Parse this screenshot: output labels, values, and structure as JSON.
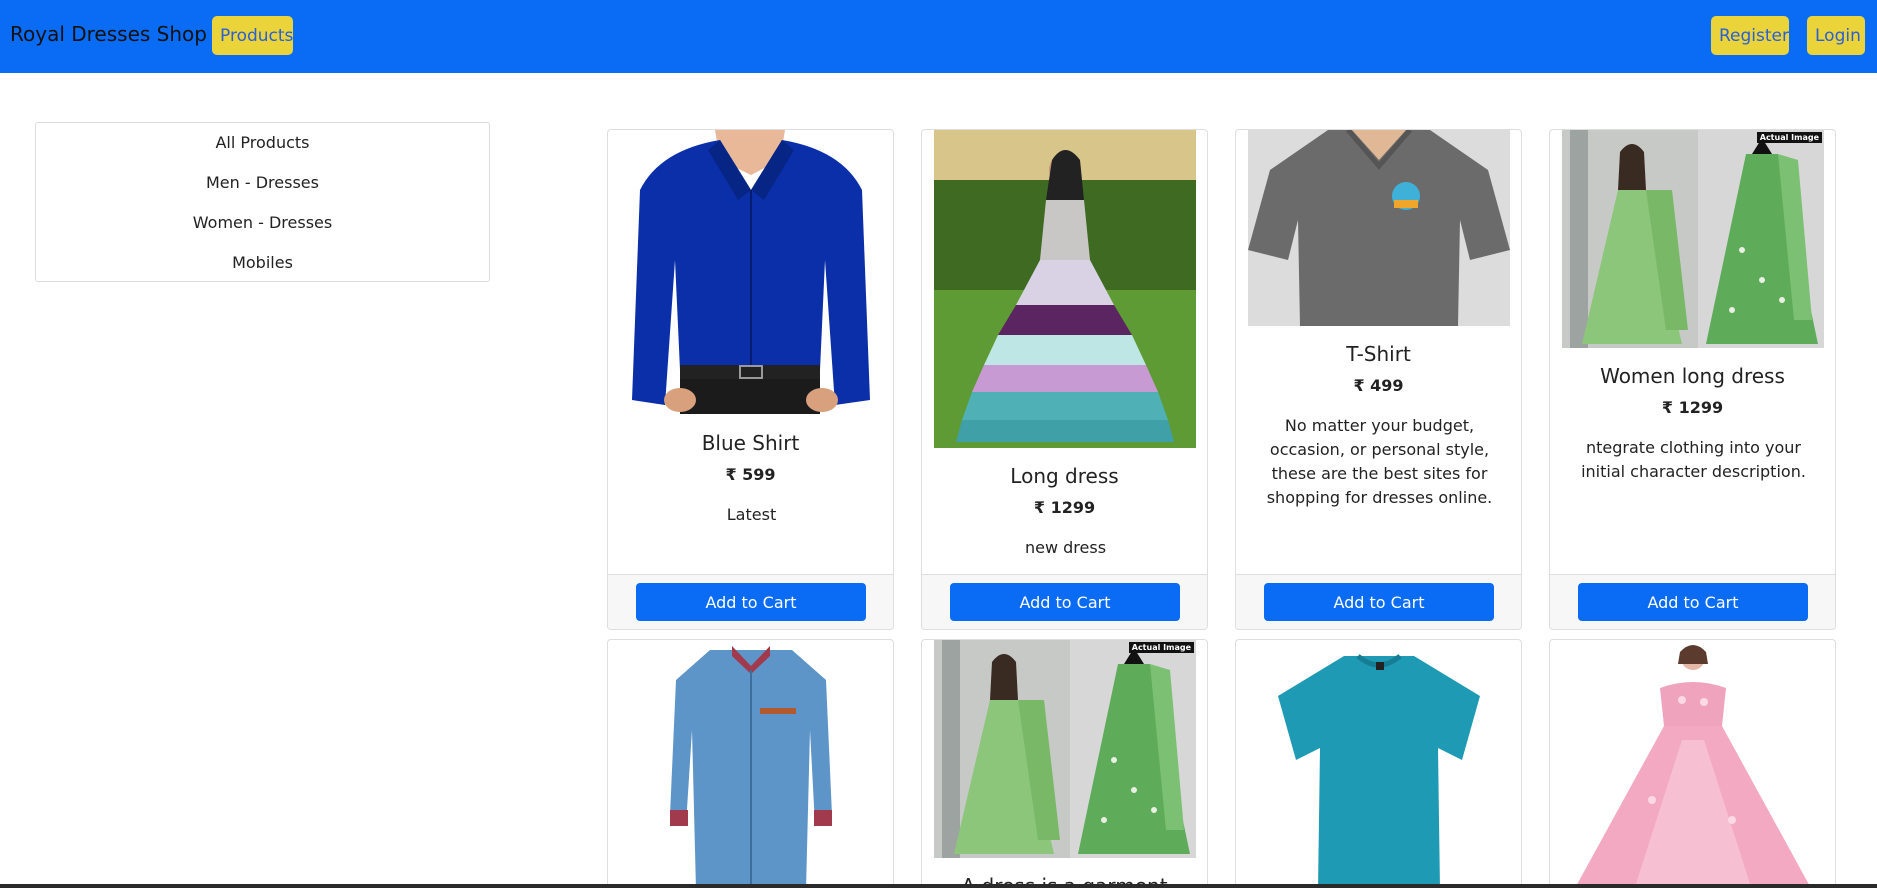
{
  "navbar": {
    "brand": "Royal Dresses Shop",
    "products_label": "Products",
    "register_label": "Register",
    "login_label": "Login"
  },
  "sidebar": {
    "items": [
      {
        "label": "All Products"
      },
      {
        "label": "Men - Dresses"
      },
      {
        "label": "Women - Dresses"
      },
      {
        "label": "Mobiles"
      }
    ]
  },
  "products": [
    {
      "title": "Blue Shirt",
      "price": "₹ 599",
      "description": "Latest",
      "button": "Add to Cart"
    },
    {
      "title": "Long dress",
      "price": "₹ 1299",
      "description": "new dress",
      "button": "Add to Cart"
    },
    {
      "title": "T-Shirt",
      "price": "₹ 499",
      "description": "No matter your budget, occasion, or personal style, these are the best sites for shopping for dresses online.",
      "button": "Add to Cart"
    },
    {
      "title": "Women long dress",
      "price": "₹ 1299",
      "description": "ntegrate clothing into your initial character description.",
      "button": "Add to Cart",
      "badge": "Actual Image"
    },
    {
      "title": "",
      "price": "",
      "description": "",
      "button": ""
    },
    {
      "title": "A dress is a garment",
      "price": "",
      "description": "",
      "button": "",
      "badge": "Actual Image"
    },
    {
      "title": "",
      "price": "",
      "description": "",
      "button": ""
    },
    {
      "title": "",
      "price": "",
      "description": "",
      "button": ""
    }
  ],
  "colors": {
    "navbar": "#0a6cf5",
    "nav_button": "#ead43a",
    "primary_button": "#0a6cf5"
  }
}
